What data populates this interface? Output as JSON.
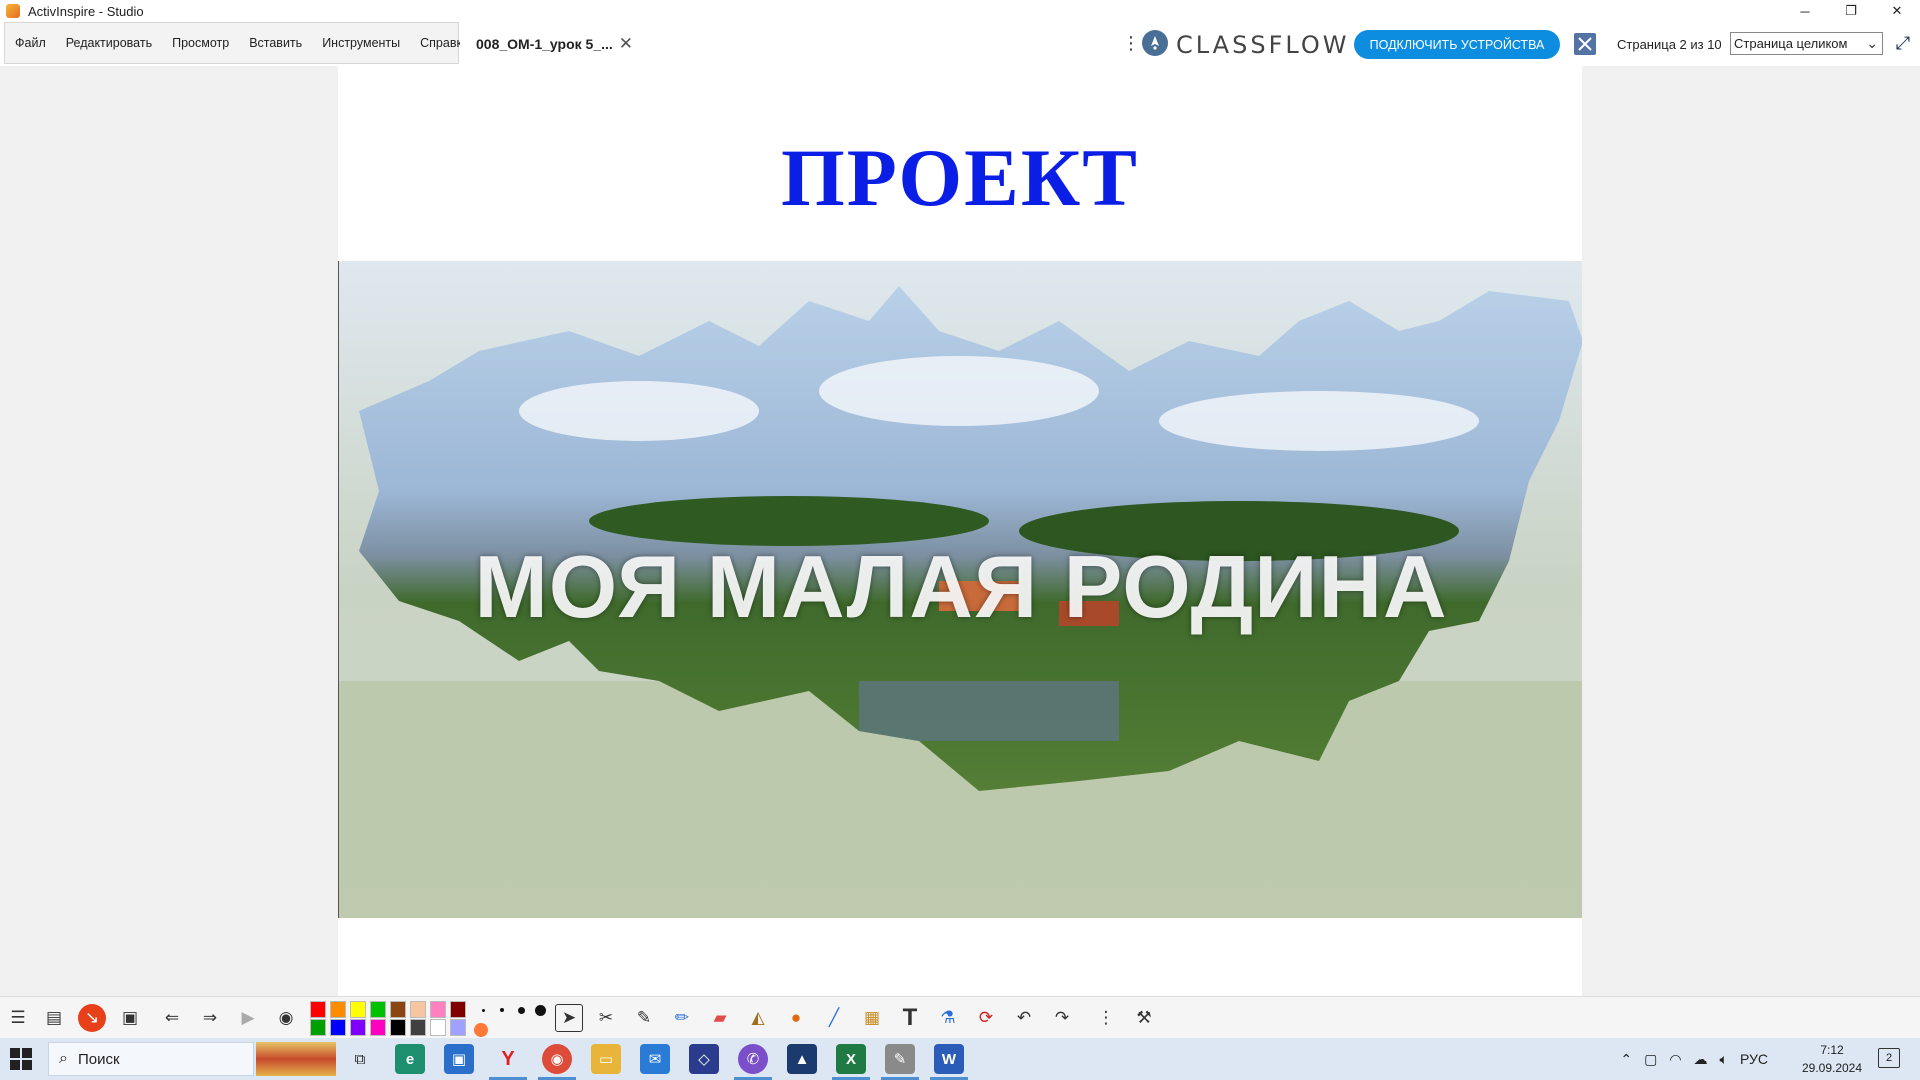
{
  "window": {
    "title": "ActivInspire - Studio"
  },
  "window_controls": {
    "minimize": "─",
    "restore": "❐",
    "close": "✕"
  },
  "menu": [
    {
      "label": "Файл"
    },
    {
      "label": "Редактировать"
    },
    {
      "label": "Просмотр"
    },
    {
      "label": "Вставить"
    },
    {
      "label": "Инструменты"
    },
    {
      "label": "Справка"
    }
  ],
  "document_tab": {
    "label": "008_ОМ-1_урок 5_...",
    "close": "✕"
  },
  "classflow": {
    "logo_text": "CLASSFLOW",
    "connect_button": "ПОДКЛЮЧИТЬ УСТРОЙСТВА"
  },
  "page_counter": "Страница 2 из 10",
  "zoom": {
    "selected": "Страница целиком"
  },
  "slide": {
    "title": "ПРОЕКТ",
    "caption": "МОЯ МАЛАЯ РОДИНА",
    "title_color": "#0a1ee6"
  },
  "palette": {
    "colors": [
      "#ff0000",
      "#ff8c00",
      "#ffff00",
      "#00c000",
      "#8b4513",
      "#f5c6a0",
      "#ff80c0",
      "#800000",
      "#00a000",
      "#0000ff",
      "#8000ff",
      "#ff00c0",
      "#000000",
      "#404040",
      "#ffffff",
      "#a0a0ff"
    ]
  },
  "taskbar": {
    "search_placeholder": "Поиск",
    "language": "РУС",
    "time": "7:12",
    "date": "29.09.2024",
    "notifications": "2"
  }
}
